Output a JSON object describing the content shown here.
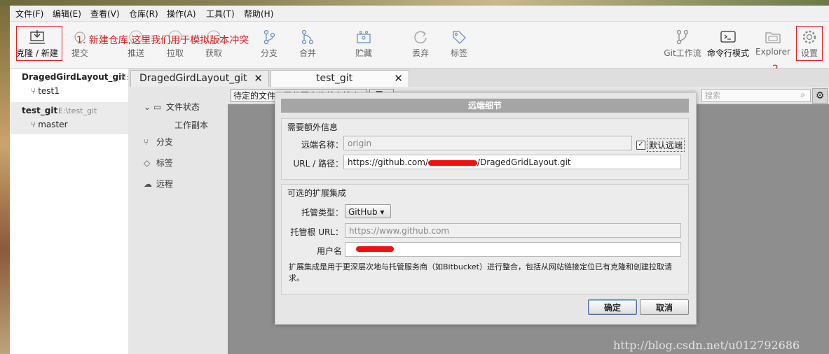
{
  "menu": [
    "文件(F)",
    "编辑(E)",
    "查看(V)",
    "仓库(R)",
    "操作(A)",
    "工具(T)",
    "帮助(H)"
  ],
  "toolbar": {
    "clone_new": "克隆 / 新建",
    "commit": "提交",
    "push": "推送",
    "pull": "拉取",
    "fetch": "获取",
    "branch": "分支",
    "merge": "合并",
    "stash": "贮藏",
    "discard": "丢弃",
    "tag": "标签",
    "git_flow": "Git工作流",
    "terminal": "命令行模式",
    "explorer": "Explorer",
    "settings": "设置"
  },
  "annotations": {
    "note1": "1.  新建仓库,这里我们用于模拟版本冲突",
    "note2": "2."
  },
  "repos": [
    {
      "name": "DragedGirdLayout_git",
      "path": "E:",
      "branch": "test1"
    },
    {
      "name": "test_git",
      "path": "E:\\test_git",
      "branch": "master"
    }
  ],
  "tabs": [
    "DragedGirdLayout_git",
    "test_git"
  ],
  "nav": {
    "file_status": "文件状态",
    "working_copy": "工作副本",
    "branches": "分支",
    "tags": "标签",
    "remotes": "远程"
  },
  "filter": {
    "pending": "待定的文件，已依照文件状态排序",
    "search_placeholder": "搜索"
  },
  "dialog": {
    "title": "远端细节",
    "required_group": "需要额外信息",
    "remote_name_label": "远端名称：",
    "remote_name_value": "origin",
    "default_remote_label": "默认远端",
    "default_remote_checked": true,
    "url_label": "URL / 路径：",
    "url_prefix": "https://github.com/",
    "url_suffix": "/DragedGridLayout.git",
    "optional_group": "可选的扩展集成",
    "host_type_label": "托管类型：",
    "host_type_value": "GitHub",
    "host_root_label": "托管根 URL：",
    "host_root_value": "https://www.github.com",
    "username_label": "用户名",
    "description": "扩展集成是用于更深层次地与托管服务商（如Bitbucket）进行整合，包括从网站链接定位已有克隆和创建拉取请求。",
    "ok": "确定",
    "cancel": "取消"
  },
  "watermark": "http://blog.csdn.net/u012792686",
  "colors": {
    "annotation": "#e02020",
    "redaction": "#ee1111"
  }
}
